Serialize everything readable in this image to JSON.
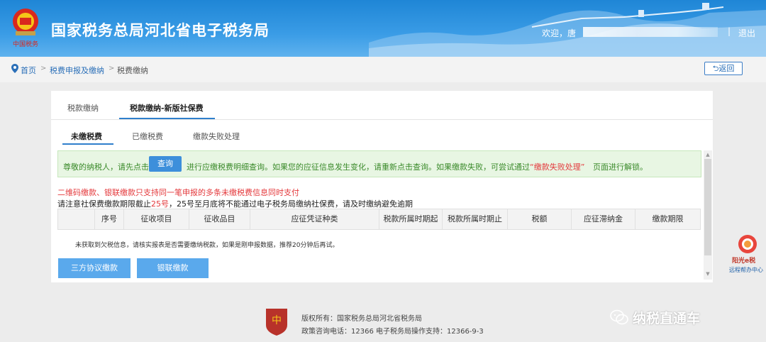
{
  "header": {
    "site_title": "国家税务总局河北省电子税务局",
    "welcome": "欢迎，唐",
    "separator": "|",
    "logout": "退出",
    "colors": {
      "bar": "#2b8fe0",
      "text": "#ffffff"
    }
  },
  "breadcrumb": {
    "home": "首页",
    "item1": "税费申报及缴纳",
    "current": "税费缴纳",
    "separator": ">",
    "back_label": "返回"
  },
  "tabs_primary": [
    {
      "label": "税款缴纳",
      "active": false
    },
    {
      "label": "税款缴纳-新版社保费",
      "active": true
    }
  ],
  "tabs_secondary": [
    {
      "label": "未缴税费",
      "active": true
    },
    {
      "label": "已缴税费",
      "active": false
    },
    {
      "label": "缴款失败处理",
      "active": false
    }
  ],
  "notice": {
    "prefix": "尊敬的纳税人，请先点击",
    "query_button": "查询",
    "middle": "进行应缴税费明细查询。如果您的应征信息发生变化，请重新点击查询。如果缴款失败，可尝试通过",
    "link": "“缴款失败处理”",
    "suffix": "页面进行解锁。"
  },
  "warning_red": "二维码缴款、银联缴款只支持同一笔申报的多条未缴税费信息同时支付",
  "deadline": {
    "prefix": "请注意社保费缴款期限截止",
    "highlight": "25号",
    "suffix": "，25号至月底将不能通过电子税务局缴纳社保费，请及时缴纳避免逾期"
  },
  "table": {
    "columns": [
      "",
      "序号",
      "征收项目",
      "征收品目",
      "应征凭证种类",
      "税款所属时期起",
      "税款所属时期止",
      "税额",
      "应征滞纳金",
      "缴款期限"
    ],
    "empty_message": "未获取到欠税信息，请核实报表是否需要缴纳税款，如果是刚申报数据，推荐20分钟后再试。"
  },
  "buttons": {
    "tripartite": "三方协议缴款",
    "unionpay": "银联缴款"
  },
  "helper": {
    "title": "阳光e税",
    "subtitle": "远程帮办中心"
  },
  "footer": {
    "copyright": "版权所有：国家税务总局河北省税务局",
    "contact": "政策咨询电话：12366    电子税务局操作支持：12366-9-3"
  },
  "watermark": "纳税直通车"
}
